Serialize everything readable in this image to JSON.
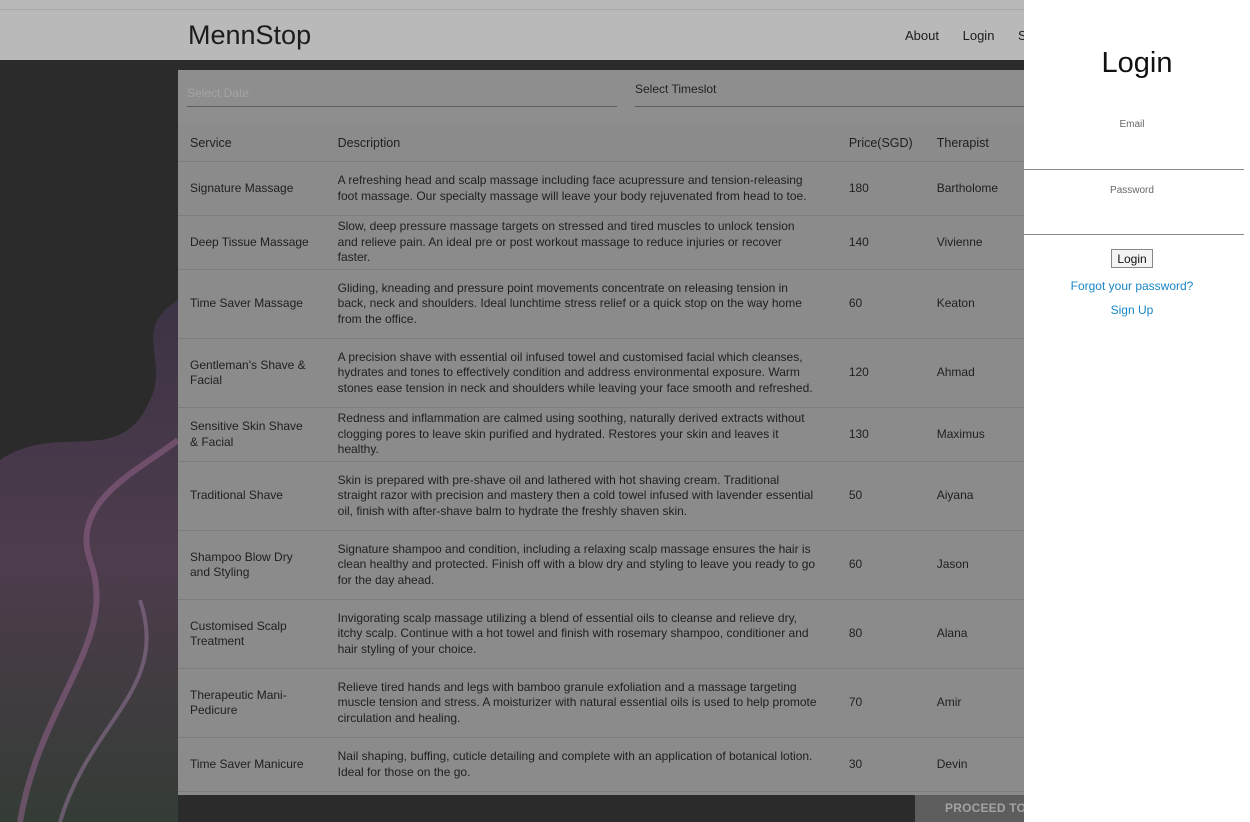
{
  "nav": {
    "brand": "MennStop",
    "links": [
      "About",
      "Login",
      "Si"
    ]
  },
  "booking": {
    "date_placeholder": "Select Date",
    "timeslot_label": "Select Timeslot",
    "proceed_label": "PROCEED TO"
  },
  "table": {
    "headers": [
      "Service",
      "Description",
      "Price(SGD)",
      "Therapist"
    ],
    "rows": [
      {
        "service": "Signature Massage",
        "description": "A refreshing head and scalp massage including face acupressure and tension-releasing foot massage. Our specialty massage will leave your body rejuvenated from head to toe.",
        "price": "180",
        "therapist": "Bartholome"
      },
      {
        "service": "Deep Tissue Massage",
        "description": "Slow, deep pressure massage targets on stressed and tired muscles to unlock tension and relieve pain. An ideal pre or post workout massage to reduce injuries or recover faster.",
        "price": "140",
        "therapist": "Vivienne"
      },
      {
        "service": "Time Saver Massage",
        "description": "Gliding, kneading and pressure point movements concentrate on releasing tension in back, neck and shoulders. Ideal lunchtime stress relief or a quick stop on the way home from the office.",
        "price": "60",
        "therapist": "Keaton"
      },
      {
        "service": "Gentleman's Shave & Facial",
        "description": "A precision shave with essential oil infused towel and customised facial which cleanses, hydrates and tones to effectively condition and address environmental exposure. Warm stones ease tension in neck and shoulders while leaving your face smooth and refreshed.",
        "price": "120",
        "therapist": "Ahmad"
      },
      {
        "service": "Sensitive Skin Shave & Facial",
        "description": "Redness and inflammation are calmed using soothing, naturally derived extracts without clogging pores to leave skin purified and hydrated. Restores your skin and leaves it healthy.",
        "price": "130",
        "therapist": "Maximus"
      },
      {
        "service": "Traditional Shave",
        "description": "Skin is prepared with pre-shave oil and lathered with hot shaving cream. Traditional straight razor with precision and mastery then a cold towel infused with lavender essential oil, finish with after-shave balm to hydrate the freshly shaven skin.",
        "price": "50",
        "therapist": "Aiyana"
      },
      {
        "service": "Shampoo Blow Dry and Styling",
        "description": "Signature shampoo and condition, including a relaxing scalp massage ensures the hair is clean healthy and protected. Finish off with a blow dry and styling to leave you ready to go for the day ahead.",
        "price": "60",
        "therapist": "Jason"
      },
      {
        "service": "Customised Scalp Treatment",
        "description": "Invigorating scalp massage utilizing a blend of essential oils to cleanse and relieve dry, itchy scalp. Continue with a hot towel and finish with rosemary shampoo, conditioner and hair styling of your choice.",
        "price": "80",
        "therapist": "Alana"
      },
      {
        "service": "Therapeutic Mani-Pedicure",
        "description": "Relieve tired hands and legs with bamboo granule exfoliation and a massage targeting muscle tension and stress. A moisturizer with natural essential oils is used to help promote circulation and healing.",
        "price": "70",
        "therapist": "Amir"
      },
      {
        "service": "Time Saver Manicure",
        "description": "Nail shaping, buffing, cuticle detailing and complete with an application of botanical lotion. Ideal for those on the go.",
        "price": "30",
        "therapist": "Devin"
      }
    ]
  },
  "login_panel": {
    "title": "Login",
    "email_label": "Email",
    "password_label": "Password",
    "login_button": "Login",
    "forgot_link": "Forgot your password?",
    "signup_link": "Sign Up",
    "link_color": "#1a86c6"
  }
}
